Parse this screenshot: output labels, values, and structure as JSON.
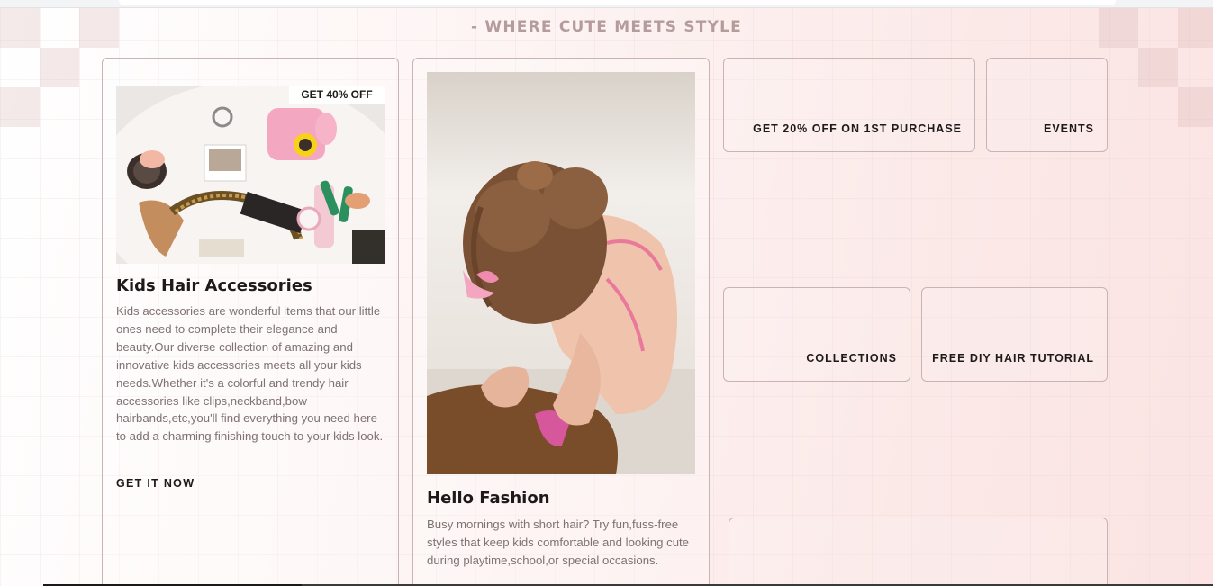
{
  "header": {
    "tagline": "- WHERE CUTE MEETS STYLE"
  },
  "cards": [
    {
      "badge": "GET 40% OFF",
      "image_alt": "Flat lay of kids hair accessories, sunglasses and a pink toy camera",
      "title": "Kids Hair Accessories",
      "description": "Kids accessories are wonderful items that our little ones need to complete their elegance and beauty.Our diverse collection of amazing and innovative kids accessories meets all your kids needs.Whether it's a colorful and trendy hair accessories like clips,neckband,bow hairbands,etc,you'll find everything you need here to add a charming finishing touch to your kids look.",
      "cta": "GET IT NOW"
    },
    {
      "image_alt": "Little girl with hair buns and a pink clip playing on the floor",
      "title": "Hello Fashion",
      "description": "Busy mornings with short hair? Try fun,fuss-free styles that keep kids comfortable and looking cute during playtime,school,or special occasions."
    }
  ],
  "tiles": {
    "promo": "GET 20% OFF ON 1ST PURCHASE",
    "events": "EVENTS",
    "collections": "COLLECTIONS",
    "tutorial": "FREE DIY HAIR TUTORIAL"
  },
  "colors": {
    "accent_text": "#b59c9c",
    "border": "#c9b3b5",
    "body_text": "#7e7273",
    "heading": "#1f1a1a"
  }
}
